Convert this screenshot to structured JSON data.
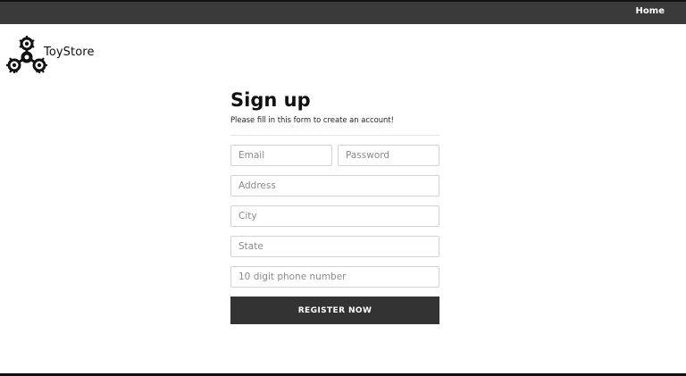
{
  "nav": {
    "home_label": "Home"
  },
  "brand": {
    "name": "ToyStore",
    "logo_icon": "fidget-spinner-icon"
  },
  "form": {
    "title": "Sign up",
    "subtitle": "Please fill in this form to create an account!",
    "email_placeholder": "Email",
    "password_placeholder": "Password",
    "address_placeholder": "Address",
    "city_placeholder": "City",
    "state_placeholder": "State",
    "phone_placeholder": "10 digit phone number",
    "submit_label": "REGISTER NOW"
  },
  "colors": {
    "topbar": "#3a3a3a",
    "button": "#333333",
    "field_border": "#d3d3d3"
  }
}
